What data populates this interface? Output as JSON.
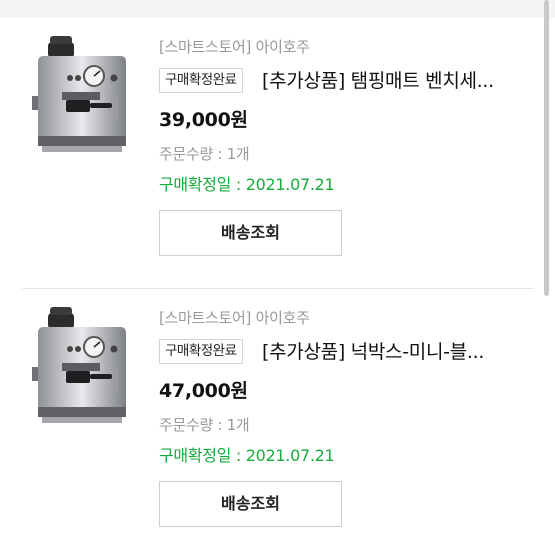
{
  "orders": [
    {
      "store": "[스마트스토어] 아이호주",
      "status": "구매확정완료",
      "title": "[추가상품] 탬핑매트 벤치세...",
      "price": "39,000원",
      "quantity": "주문수량 : 1개",
      "confirm_date": "구매확정일 : 2021.07.21",
      "button_label": "배송조회",
      "image_icon": "espresso-machine-icon"
    },
    {
      "store": "[스마트스토어] 아이호주",
      "status": "구매확정완료",
      "title": "[추가상품] 넉박스-미니-블...",
      "price": "47,000원",
      "quantity": "주문수량 : 1개",
      "confirm_date": "구매확정일 : 2021.07.21",
      "button_label": "배송조회",
      "image_icon": "espresso-machine-icon"
    }
  ],
  "colors": {
    "confirm_green": "#19ab3c",
    "muted_gray": "#9a9a9a",
    "border_gray": "#d4d4d4"
  }
}
